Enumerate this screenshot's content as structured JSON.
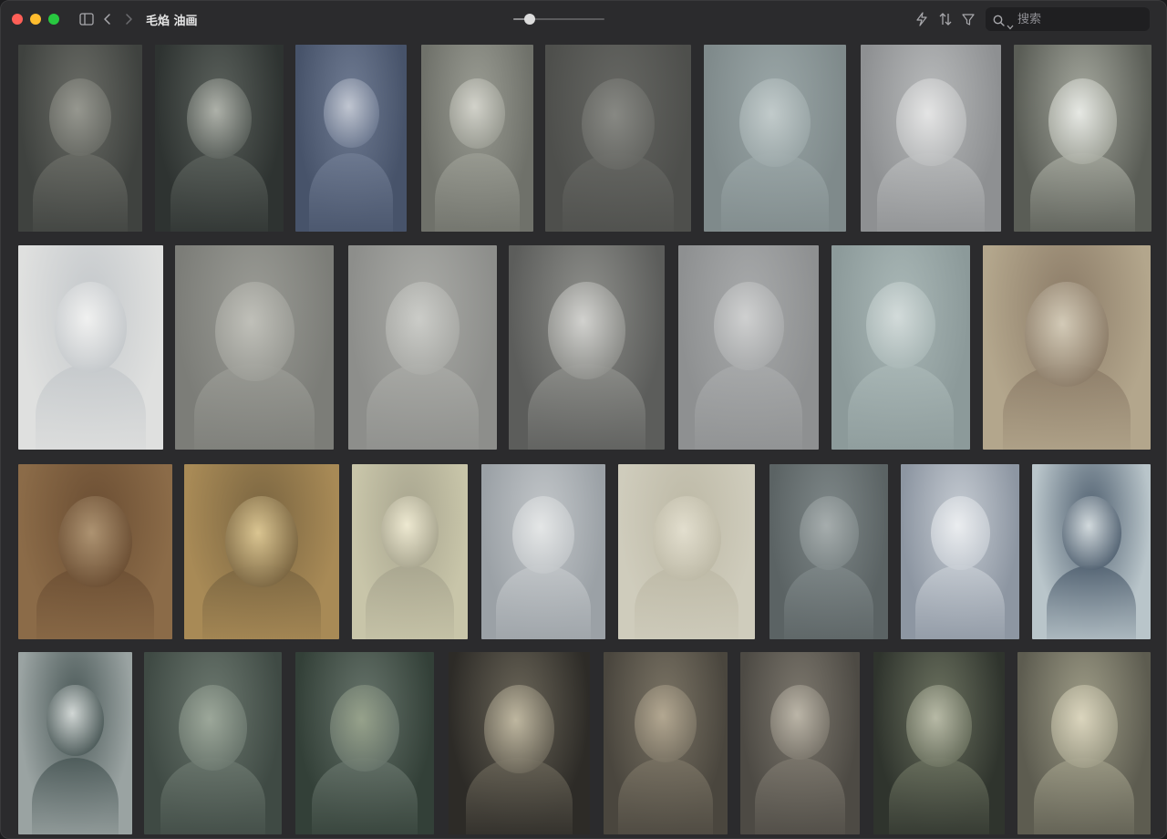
{
  "window": {
    "title": "毛焰 油画"
  },
  "toolbar": {
    "thumbnail_size": 0.18,
    "search": {
      "placeholder": "搜索",
      "value": ""
    }
  },
  "colors": {
    "window_bg": "#2b2b2d",
    "close": "#ff5f57",
    "minimize": "#febc2e",
    "zoom": "#28c840"
  },
  "gallery": {
    "rows": [
      [
        {
          "bg": "#3f423f",
          "mid": "#6a6c66",
          "light": "#9b9c94"
        },
        {
          "bg": "#2e3331",
          "mid": "#5b615c",
          "light": "#b7bab2"
        },
        {
          "bg": "#47536a",
          "mid": "#6f7b92",
          "light": "#c9ced8"
        },
        {
          "bg": "#6f716a",
          "mid": "#9a9c93",
          "light": "#d8d8d0"
        },
        {
          "bg": "#4e4f4c",
          "mid": "#666763",
          "light": "#8b8c87"
        },
        {
          "bg": "#7f8a8b",
          "mid": "#9aa6a7",
          "light": "#c6cfcf"
        },
        {
          "bg": "#8e9092",
          "mid": "#b8babb",
          "light": "#e9e9e9"
        },
        {
          "bg": "#5a5d56",
          "mid": "#a4a79d",
          "light": "#eef0ec"
        }
      ],
      [
        {
          "bg": "#dfe0df",
          "mid": "#c4c8cb",
          "light": "#f5f5f4"
        },
        {
          "bg": "#7c7d78",
          "mid": "#9a9b95",
          "light": "#c4c4bd"
        },
        {
          "bg": "#8d8e8b",
          "mid": "#a9aaa6",
          "light": "#cfd0cc"
        },
        {
          "bg": "#5c5d5b",
          "mid": "#8e8f8b",
          "light": "#d9d9d6"
        },
        {
          "bg": "#8e9091",
          "mid": "#a8aaab",
          "light": "#d3d4d4"
        },
        {
          "bg": "#8c9a9a",
          "mid": "#a9b7b6",
          "light": "#d7dfde"
        },
        {
          "bg": "#b3a68c",
          "mid": "#8b7b67",
          "light": "#dad2bf"
        }
      ],
      [
        {
          "bg": "#8b6b48",
          "mid": "#6b4e33",
          "light": "#b49a78"
        },
        {
          "bg": "#a88a56",
          "mid": "#7a6541",
          "light": "#e4cf9a"
        },
        {
          "bg": "#c8c5a9",
          "mid": "#a8a58f",
          "light": "#f5f0d8"
        },
        {
          "bg": "#9ba1a6",
          "mid": "#c2c6c9",
          "light": "#e8eaea"
        },
        {
          "bg": "#cfccbc",
          "mid": "#bdb9a6",
          "light": "#e6e2d2"
        },
        {
          "bg": "#5b6364",
          "mid": "#7e8788",
          "light": "#aab1b1"
        },
        {
          "bg": "#8d96a2",
          "mid": "#c5cbd2",
          "light": "#eff1f3"
        },
        {
          "bg": "#b9c5ca",
          "mid": "#506070",
          "light": "#dfe6e8"
        }
      ],
      [
        {
          "bg": "#9aa3a2",
          "mid": "#4a5857",
          "light": "#dfe4e2"
        },
        {
          "bg": "#3f4a44",
          "mid": "#6b776e",
          "light": "#a2ad9f"
        },
        {
          "bg": "#334038",
          "mid": "#66736a",
          "light": "#9ca78f"
        },
        {
          "bg": "#2d2b27",
          "mid": "#6a6558",
          "light": "#c8c0a8"
        },
        {
          "bg": "#4a463e",
          "mid": "#7a7364",
          "light": "#b9ad96"
        },
        {
          "bg": "#4d4a44",
          "mid": "#7c776d",
          "light": "#c2bcae"
        },
        {
          "bg": "#2f342d",
          "mid": "#6b715f",
          "light": "#c0c2ae"
        },
        {
          "bg": "#5d5c50",
          "mid": "#9d9b86",
          "light": "#e2dcc4"
        }
      ]
    ]
  }
}
